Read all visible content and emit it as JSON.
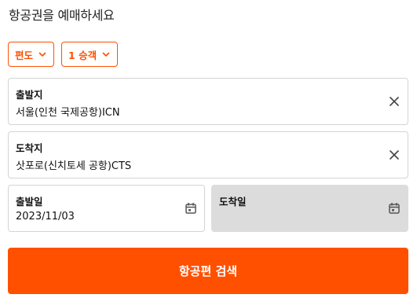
{
  "header": {
    "title": "항공권을 예매하세요"
  },
  "options": {
    "trip_type": {
      "label": "편도",
      "icon": "chevron-down-icon"
    },
    "passengers": {
      "label": "1 승객",
      "icon": "chevron-down-icon"
    }
  },
  "departure": {
    "label": "출발지",
    "value": "서울(인천 국제공항)ICN",
    "icon": "close-icon"
  },
  "arrival": {
    "label": "도착지",
    "value": "삿포로(신치토세 공항)CTS",
    "icon": "close-icon"
  },
  "departure_date": {
    "label": "출발일",
    "value": "2023/11/03",
    "icon": "calendar-icon"
  },
  "return_date": {
    "label": "도착일",
    "icon": "calendar-icon"
  },
  "search_button": {
    "label": "항공편 검색"
  },
  "colors": {
    "accent": "#ff5000",
    "disabled_bg": "#dcdcdc",
    "border": "#d4d4d4"
  }
}
